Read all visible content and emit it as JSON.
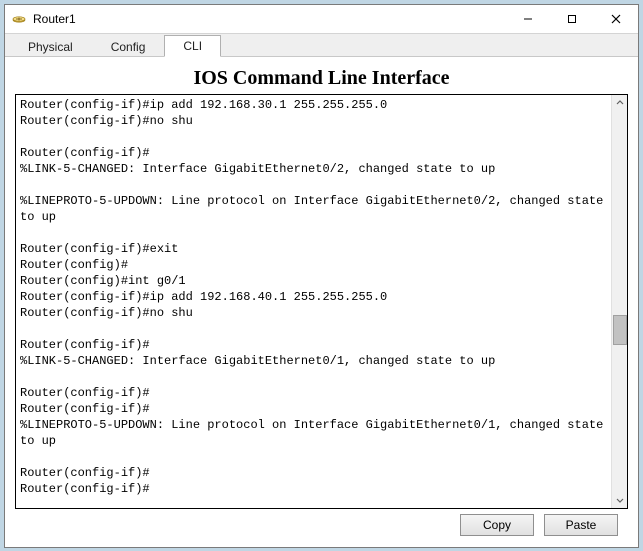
{
  "window": {
    "title": "Router1"
  },
  "tabs": {
    "physical": "Physical",
    "config": "Config",
    "cli": "CLI",
    "active": "cli"
  },
  "cli": {
    "heading": "IOS Command Line Interface",
    "output": "Router(config-if)#ip add 192.168.30.1 255.255.255.0\nRouter(config-if)#no shu\n\nRouter(config-if)#\n%LINK-5-CHANGED: Interface GigabitEthernet0/2, changed state to up\n\n%LINEPROTO-5-UPDOWN: Line protocol on Interface GigabitEthernet0/2, changed state to up\n\nRouter(config-if)#exit\nRouter(config)#\nRouter(config)#int g0/1\nRouter(config-if)#ip add 192.168.40.1 255.255.255.0\nRouter(config-if)#no shu\n\nRouter(config-if)#\n%LINK-5-CHANGED: Interface GigabitEthernet0/1, changed state to up\n\nRouter(config-if)#\nRouter(config-if)#\n%LINEPROTO-5-UPDOWN: Line protocol on Interface GigabitEthernet0/1, changed state to up\n\nRouter(config-if)#\nRouter(config-if)#"
  },
  "buttons": {
    "copy": "Copy",
    "paste": "Paste"
  }
}
